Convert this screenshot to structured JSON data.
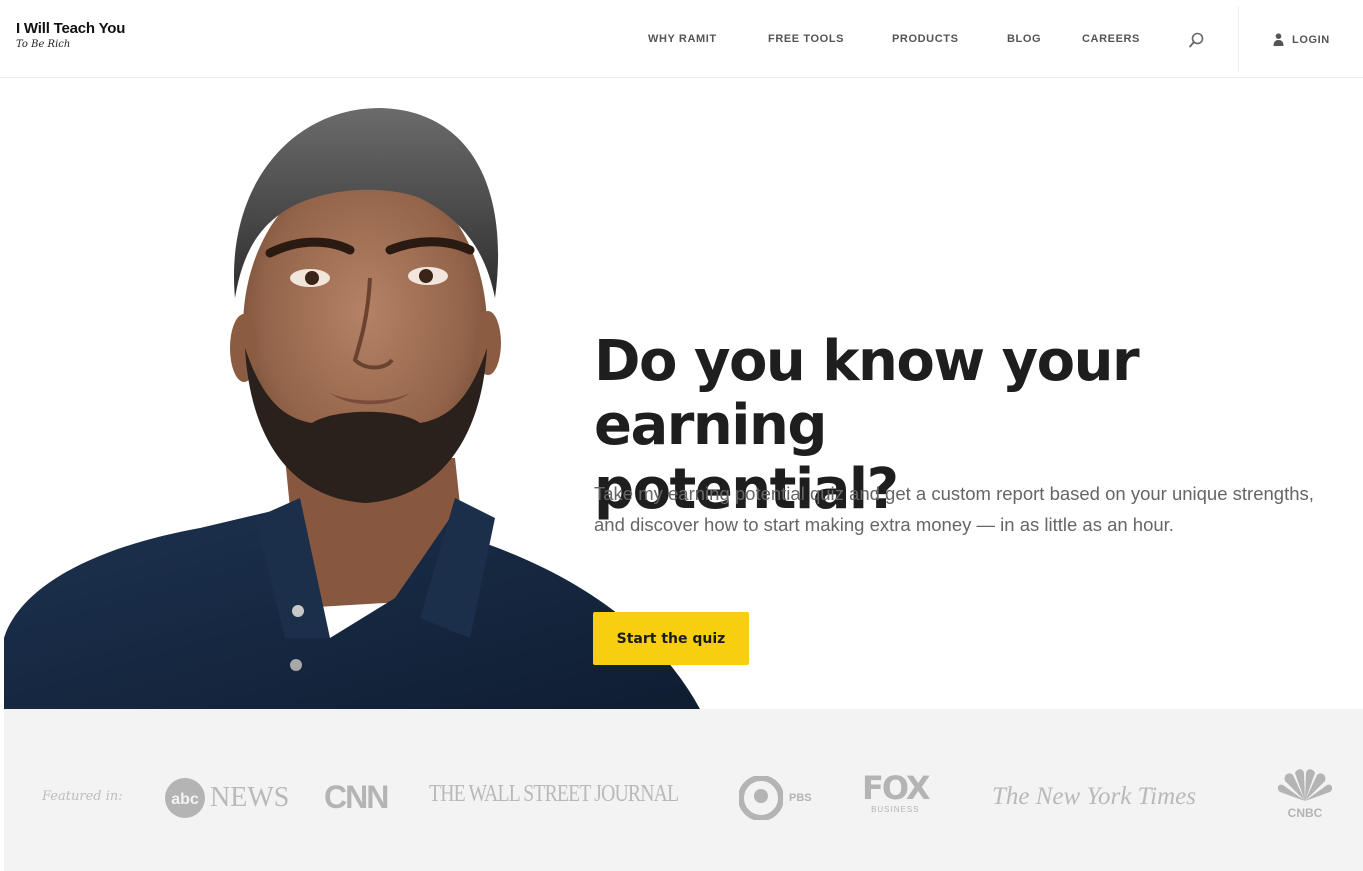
{
  "brand": {
    "name": "I Will Teach You",
    "tagline": "To Be Rich"
  },
  "nav": {
    "items": [
      "WHY RAMIT",
      "FREE TOOLS",
      "PRODUCTS",
      "BLOG",
      "CAREERS"
    ],
    "login_label": "LOGIN"
  },
  "hero": {
    "headline_line1": "Do you know your earning",
    "headline_line2": "potential?",
    "subtext": "Take my earning potential quiz and get a custom report based on your unique strengths, and discover how to start making extra money — in as little as an hour.",
    "cta_label": "Start the quiz"
  },
  "featured": {
    "label": "Featured in:",
    "outlets": {
      "abc": "NEWS",
      "cnn": "CNN",
      "wsj": "THE WALL STREET JOURNAL",
      "pbs": "PBS",
      "fox": "FOX",
      "fox_sub": "BUSINESS",
      "nyt": "The New York Times",
      "cnbc": "CNBC"
    }
  },
  "colors": {
    "cta_bg": "#f8cf10",
    "headline": "#1e1e1e",
    "featured_bg": "#f3f3f4",
    "shirt": "#16273f"
  },
  "icons": [
    "search-icon",
    "user-icon"
  ]
}
